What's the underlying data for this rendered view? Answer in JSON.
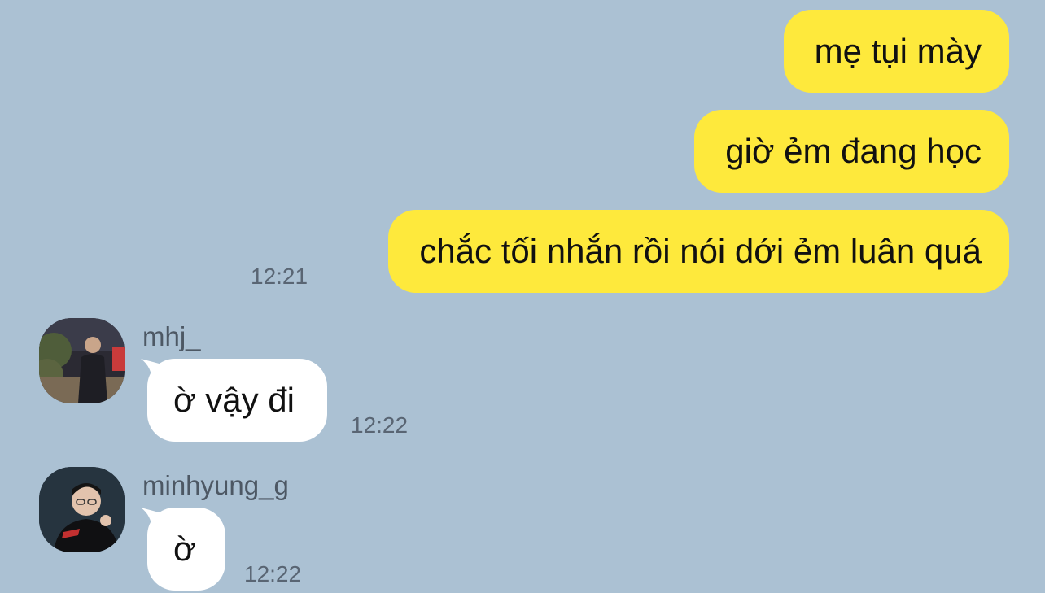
{
  "sent_messages": [
    {
      "text": "mẹ tụi mày"
    },
    {
      "text": "giờ ẻm đang học"
    },
    {
      "text": "chắc tối nhắn rồi nói dới ẻm luân quá"
    }
  ],
  "sent_time": "12:21",
  "received_messages": [
    {
      "sender": "mhj_",
      "text": "ờ vậy đi",
      "time": "12:22",
      "avatar": "avatar-photo"
    },
    {
      "sender": "minhyung_g",
      "text": "ờ",
      "time": "12:22",
      "avatar": "avatar-photo"
    }
  ],
  "colors": {
    "background": "#abc1d3",
    "sent_bubble": "#fee93c",
    "received_bubble": "#ffffff",
    "timestamp": "#596573"
  }
}
